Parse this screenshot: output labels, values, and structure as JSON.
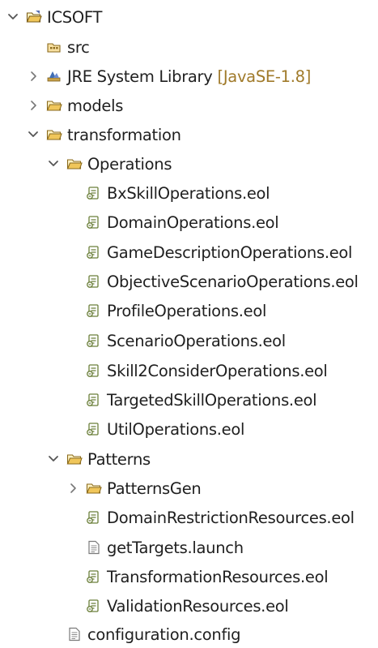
{
  "tree": {
    "project": {
      "label": "ICSOFT",
      "icon": "project-folder-icon"
    },
    "src": {
      "label": "src",
      "icon": "package-folder-icon"
    },
    "jre": {
      "label": "JRE System Library",
      "decoration": "[JavaSE-1.8]",
      "icon": "library-icon"
    },
    "models": {
      "label": "models",
      "icon": "folder-icon"
    },
    "transformation": {
      "label": "transformation",
      "icon": "folder-icon"
    },
    "operations": {
      "label": "Operations",
      "icon": "folder-icon",
      "files": [
        "BxSkillOperations.eol",
        "DomainOperations.eol",
        "GameDescriptionOperations.eol",
        "ObjectiveScenarioOperations.eol",
        "ProfileOperations.eol",
        "ScenarioOperations.eol",
        "Skill2ConsiderOperations.eol",
        "TargetedSkillOperations.eol",
        "UtilOperations.eol"
      ]
    },
    "patterns": {
      "label": "Patterns",
      "icon": "folder-icon",
      "patterns_gen": "PatternsGen",
      "files": [
        "DomainRestrictionResources.eol",
        "getTargets.launch",
        "TransformationResources.eol",
        "ValidationResources.eol"
      ]
    },
    "configuration": {
      "label": "configuration.config",
      "icon": "text-file-icon"
    }
  },
  "colors": {
    "folder": "#e8b84a",
    "eol_icon": "#6b7f3a",
    "library": "#3f6db3",
    "decoration": "#a07a2a",
    "arrow": "#555555"
  }
}
